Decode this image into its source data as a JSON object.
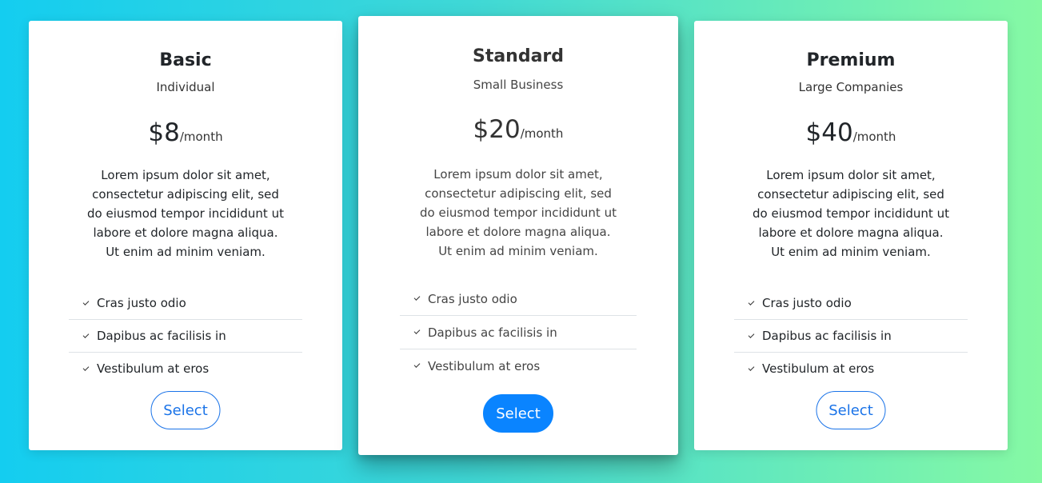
{
  "plans": [
    {
      "name": "Basic",
      "subtitle": "Individual",
      "price": "$8",
      "period": "/month",
      "description": "Lorem ipsum dolor sit amet, consectetur adipiscing elit, sed do eiusmod tempor incididunt ut labore et dolore magna aliqua. Ut enim ad minim veniam.",
      "features": [
        "Cras justo odio",
        "Dapibus ac facilisis in",
        "Vestibulum at eros"
      ],
      "button": "Select"
    },
    {
      "name": "Standard",
      "subtitle": "Small Business",
      "price": "$20",
      "period": "/month",
      "description": "Lorem ipsum dolor sit amet, consectetur adipiscing elit, sed do eiusmod tempor incididunt ut labore et dolore magna aliqua. Ut enim ad minim veniam.",
      "features": [
        "Cras justo odio",
        "Dapibus ac facilisis in",
        "Vestibulum at eros"
      ],
      "button": "Select"
    },
    {
      "name": "Premium",
      "subtitle": "Large Companies",
      "price": "$40",
      "period": "/month",
      "description": "Lorem ipsum dolor sit amet, consectetur adipiscing elit, sed do eiusmod tempor incididunt ut labore et dolore magna aliqua. Ut enim ad minim veniam.",
      "features": [
        "Cras justo odio",
        "Dapibus ac facilisis in",
        "Vestibulum at eros"
      ],
      "button": "Select"
    }
  ],
  "colors": {
    "background_start": "#14cdf0",
    "background_end": "#86f9a4",
    "accent": "#1a73e8",
    "primary_button": "#0a84ff"
  },
  "icons": {
    "feature_bullet": "check-icon"
  }
}
